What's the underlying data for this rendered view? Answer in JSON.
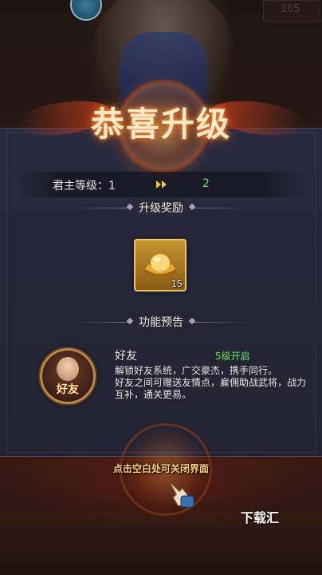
{
  "top": {
    "number": "165"
  },
  "title": "恭喜升级",
  "level": {
    "label": "君主等级：1",
    "next": "2"
  },
  "sections": {
    "reward": "升级奖励",
    "preview": "功能预告"
  },
  "reward_item": {
    "icon": "gold-ingot-icon",
    "count": "15"
  },
  "feature": {
    "badge_text": "好友",
    "name": "好友",
    "unlock": "5级开启",
    "desc_line1": "解锁好友系统，广交豪杰，携手同行。",
    "desc_line2": "好友之间可赠送友情点，雇佣助战武将，战力互补，通关更易。"
  },
  "hint": "点击空白处可关闭界面",
  "watermark": "下载汇",
  "colors": {
    "accent_green": "#69e35a",
    "title": "#fbe8c8",
    "hint": "#ffcf7a",
    "panel": "#262638"
  }
}
